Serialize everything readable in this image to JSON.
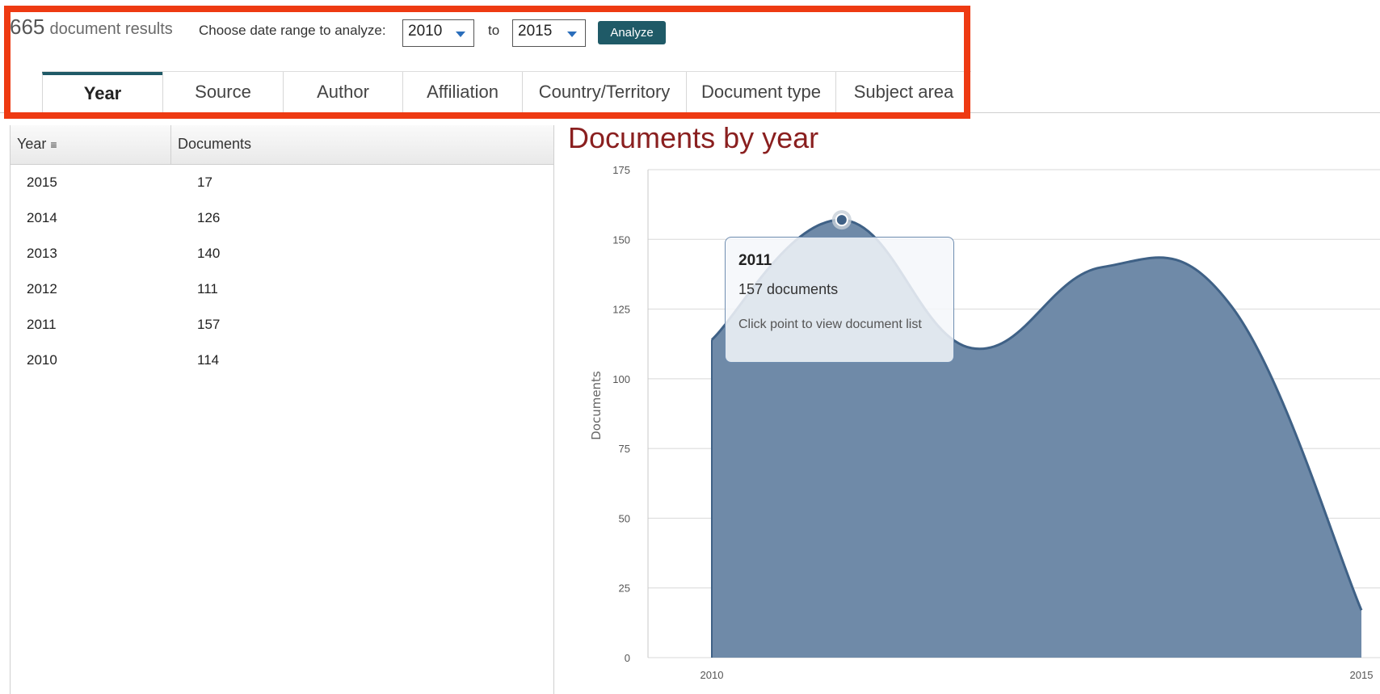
{
  "summary": {
    "count": "665",
    "label": "document results"
  },
  "range": {
    "label": "Choose date range to analyze:",
    "from": "2010",
    "to_label": "to",
    "to": "2015",
    "analyze_label": "Analyze"
  },
  "tabs": [
    {
      "label": "Year",
      "active": true
    },
    {
      "label": "Source"
    },
    {
      "label": "Author"
    },
    {
      "label": "Affiliation"
    },
    {
      "label": "Country/Territory"
    },
    {
      "label": "Document type"
    },
    {
      "label": "Subject area"
    }
  ],
  "table": {
    "headers": {
      "year": "Year",
      "documents": "Documents"
    },
    "rows": [
      {
        "year": "2015",
        "documents": "17"
      },
      {
        "year": "2014",
        "documents": "126"
      },
      {
        "year": "2013",
        "documents": "140"
      },
      {
        "year": "2012",
        "documents": "111"
      },
      {
        "year": "2011",
        "documents": "157"
      },
      {
        "year": "2010",
        "documents": "114"
      }
    ]
  },
  "chart_data": {
    "type": "area",
    "title": "Documents by year",
    "xlabel": "",
    "ylabel": "Documents",
    "x": [
      2010,
      2011,
      2012,
      2013,
      2014,
      2015
    ],
    "x_tick_labels": [
      "2010",
      "2015"
    ],
    "series": [
      {
        "values": [
          114,
          157,
          111,
          140,
          126,
          17
        ]
      }
    ],
    "ylim": [
      0,
      175
    ],
    "y_ticks": [
      "0",
      "25",
      "50",
      "75",
      "100",
      "125",
      "150",
      "175"
    ],
    "grid": true,
    "colors": {
      "fill": "#6f8aa8",
      "line": "#3f6186"
    }
  },
  "tooltip": {
    "year": "2011",
    "documents": "157 documents",
    "hint": "Click point to view document list"
  }
}
